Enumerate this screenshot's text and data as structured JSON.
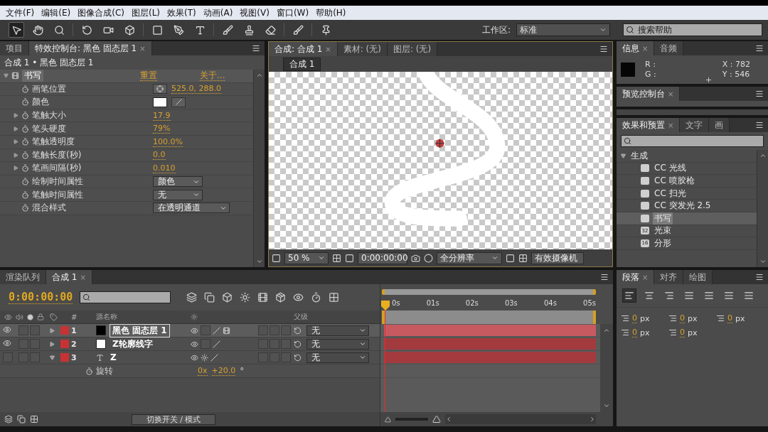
{
  "menu": [
    "文件(F)",
    "编辑(E)",
    "图像合成(C)",
    "图层(L)",
    "效果(T)",
    "动画(A)",
    "视图(V)",
    "窗口(W)",
    "帮助(H)"
  ],
  "toolbar": {
    "workspace_label": "工作区:",
    "workspace": "标准",
    "search": {
      "placeholder": "搜索帮助"
    }
  },
  "effect_controls": {
    "tabs": [
      {
        "label": "项目",
        "selected": false
      },
      {
        "label": "特效控制台: 黑色 固态层 1",
        "selected": true,
        "close": "×"
      }
    ],
    "breadcrumb": "合成 1 • 黑色 固态层 1",
    "effect": {
      "name": "书写",
      "reset": "重置",
      "about": "关于...",
      "expanded": true
    },
    "properties": [
      {
        "kind": "point",
        "name": "画笔位置",
        "value": "525.0, 288.0"
      },
      {
        "kind": "color",
        "name": "颜色"
      },
      {
        "kind": "number",
        "name": "笔触大小",
        "value": "17.9"
      },
      {
        "kind": "number",
        "name": "笔头硬度",
        "value": "79%"
      },
      {
        "kind": "number",
        "name": "笔触透明度",
        "value": "100.0%"
      },
      {
        "kind": "number",
        "name": "笔触长度(秒)",
        "value": "0.0"
      },
      {
        "kind": "number",
        "name": "笔画间隔(秒)",
        "value": "0.010"
      },
      {
        "kind": "dropdown",
        "name": "绘制时间属性",
        "value": "颜色"
      },
      {
        "kind": "dropdown",
        "name": "笔触时间属性",
        "value": "无"
      },
      {
        "kind": "dropdown",
        "name": "混合样式",
        "value": "在透明通道"
      }
    ]
  },
  "viewer": {
    "tabs": [
      {
        "label": "合成: 合成 1",
        "selected": true,
        "close": "×"
      },
      {
        "label": "素材: (无)",
        "selected": false
      },
      {
        "label": "图层: (无)",
        "selected": false
      }
    ],
    "comp_button": "合成 1",
    "zoom": "50 %",
    "timecode": "0:00:00:00",
    "resolution": "全分辨率",
    "camera": "有效摄像机"
  },
  "info": {
    "tabs": [
      {
        "label": "信息",
        "selected": true,
        "close": "×"
      },
      {
        "label": "音频",
        "selected": false
      }
    ],
    "r": "R :",
    "g": "G :",
    "x": "X : 782",
    "y": "Y : 546"
  },
  "preview": {
    "tabs": [
      {
        "label": "预览控制台",
        "selected": true,
        "close": "×"
      }
    ]
  },
  "effects_presets": {
    "tabs": [
      {
        "label": "效果和预置",
        "selected": true,
        "close": "×"
      },
      {
        "label": "文字",
        "selected": false
      },
      {
        "label": "画",
        "selected": false
      }
    ],
    "tree": [
      {
        "label": "生成",
        "expanded": true,
        "children": [
          {
            "label": "CC 光线",
            "selected": false
          },
          {
            "label": "CC 喷胶枪",
            "selected": false
          },
          {
            "label": "CC 扫光",
            "selected": false
          },
          {
            "label": "CC 突发光 2.5",
            "selected": false
          },
          {
            "label": "书写",
            "selected": true
          },
          {
            "label": "光束",
            "selected": false,
            "badge": "32"
          },
          {
            "label": "分形",
            "selected": false,
            "badge": "16"
          }
        ]
      }
    ]
  },
  "timeline": {
    "tabs": [
      {
        "label": "渲染队列",
        "selected": false
      },
      {
        "label": "合成 1",
        "selected": true,
        "close": "×"
      }
    ],
    "timecode": "0:00:00:00",
    "columns": [
      "#",
      "源名称",
      "父级"
    ],
    "ticks": [
      "0s",
      "01s",
      "02s",
      "03s",
      "04s",
      "05s"
    ],
    "layers": [
      {
        "number": "1",
        "name": "黑色 固态层 1",
        "kind": "solid",
        "color": "#000000",
        "visible": true,
        "selected": true,
        "expanded": false,
        "fx": true,
        "parent": "无"
      },
      {
        "number": "2",
        "name": "Z轮廓线字",
        "kind": "solid",
        "color": "#ffffff",
        "visible": true,
        "selected": false,
        "expanded": false,
        "fx": false,
        "parent": "无"
      },
      {
        "number": "3",
        "name": "Z",
        "kind": "text",
        "visible": false,
        "selected": false,
        "expanded": true,
        "fx": false,
        "parent": "无",
        "properties": [
          {
            "name": "旋转",
            "turns": "0x",
            "angle": "+20.0",
            "unit": "°"
          }
        ]
      }
    ],
    "mode_button": "切换开关 / 模式"
  },
  "paragraph": {
    "tabs": [
      {
        "label": "段落",
        "selected": true,
        "close": "×"
      },
      {
        "label": "对齐",
        "selected": false
      },
      {
        "label": "绘图",
        "selected": false
      }
    ],
    "indents": [
      {
        "value": "0",
        "unit": "px"
      },
      {
        "value": "0",
        "unit": "px"
      },
      {
        "value": "0",
        "unit": "px"
      },
      {
        "value": "0",
        "unit": "px"
      },
      {
        "value": "0",
        "unit": "px"
      }
    ]
  }
}
